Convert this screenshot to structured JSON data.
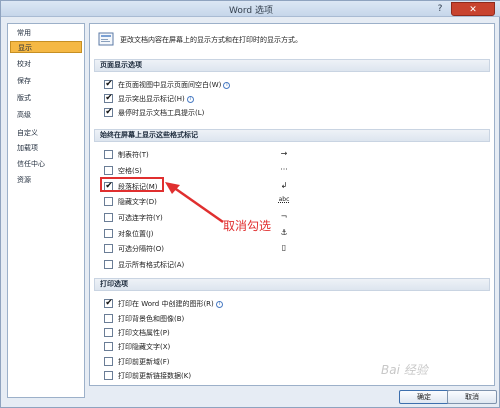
{
  "window": {
    "title": "Word 选项",
    "help": "?",
    "close": "✕"
  },
  "sidebar": {
    "items": [
      {
        "label": "常用"
      },
      {
        "label": "显示"
      },
      {
        "label": "校对"
      },
      {
        "label": "保存"
      },
      {
        "label": "版式"
      },
      {
        "label": "高级"
      },
      {
        "label": "自定义"
      },
      {
        "label": "加载项"
      },
      {
        "label": "信任中心"
      },
      {
        "label": "资源"
      }
    ],
    "active_index": 1
  },
  "banner": {
    "text": "更改文档内容在屏幕上的显示方式和在打印时的显示方式。"
  },
  "sections": {
    "page_display": "页面显示选项",
    "format_marks": "始终在屏幕上显示这些格式标记",
    "print": "打印选项"
  },
  "page_options": [
    {
      "label": "在页面视图中显示页面间空白(W)",
      "checked": true,
      "info": true
    },
    {
      "label": "显示突出显示标记(H)",
      "checked": true,
      "info": true
    },
    {
      "label": "悬停时显示文档工具提示(L)",
      "checked": true,
      "info": false
    }
  ],
  "format_marks": [
    {
      "label": "制表符(T)",
      "checked": false,
      "symbol": "→"
    },
    {
      "label": "空格(S)",
      "checked": false,
      "symbol": "···"
    },
    {
      "label": "段落标记(M)",
      "checked": true,
      "symbol": "↲"
    },
    {
      "label": "隐藏文字(D)",
      "checked": false,
      "symbol": "abc"
    },
    {
      "label": "可选连字符(Y)",
      "checked": false,
      "symbol": "¬"
    },
    {
      "label": "对象位置(J)",
      "checked": false,
      "symbol": "⚓"
    },
    {
      "label": "可选分隔符(O)",
      "checked": false,
      "symbol": "▯"
    },
    {
      "label": "显示所有格式标记(A)",
      "checked": false,
      "symbol": ""
    }
  ],
  "print_options": [
    {
      "label": "打印在 Word 中创建的图形(R)",
      "checked": true,
      "info": true
    },
    {
      "label": "打印背景色和图像(B)",
      "checked": false,
      "info": false
    },
    {
      "label": "打印文档属性(P)",
      "checked": false,
      "info": false
    },
    {
      "label": "打印隐藏文字(X)",
      "checked": false,
      "info": false
    },
    {
      "label": "打印前更新域(F)",
      "checked": false,
      "info": false
    },
    {
      "label": "打印前更新链接数据(K)",
      "checked": false,
      "info": false
    }
  ],
  "annotation": {
    "text": "取消勾选"
  },
  "buttons": {
    "ok": "确定",
    "cancel": "取消"
  },
  "watermark": "Bai 经验",
  "colors": {
    "highlight": "#e02f2f",
    "active_nav": "#f5b844"
  }
}
